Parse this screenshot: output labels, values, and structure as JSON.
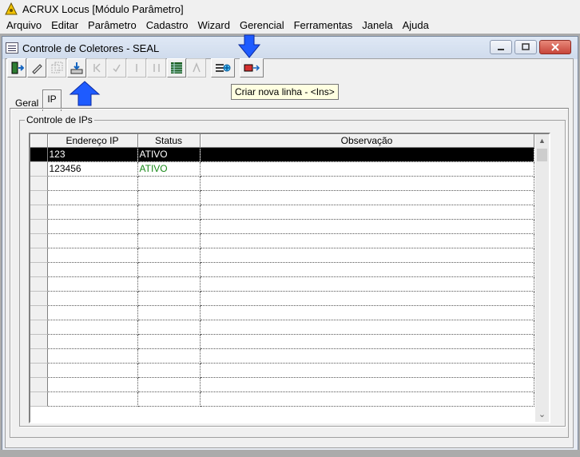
{
  "app": {
    "title": "ACRUX Locus [Módulo Parâmetro]"
  },
  "menu": [
    "Arquivo",
    "Editar",
    "Parâmetro",
    "Cadastro",
    "Wizard",
    "Gerencial",
    "Ferramentas",
    "Janela",
    "Ajuda"
  ],
  "window": {
    "title": "Controle de Coletores - SEAL"
  },
  "toolbar": {
    "tooltip": "Criar nova linha - <Ins>"
  },
  "tabs": [
    "Geral",
    "IP"
  ],
  "group": {
    "label": "Controle de IPs"
  },
  "grid": {
    "columns": [
      "Endereço IP",
      "Status",
      "Observação"
    ],
    "rows": [
      {
        "ip": "123",
        "status": "ATIVO",
        "obs": ""
      },
      {
        "ip": "123456",
        "status": "ATIVO",
        "obs": ""
      }
    ]
  },
  "colors": {
    "status_active": "#1a8a1a",
    "highlight_arrow": "#1e5bff"
  }
}
